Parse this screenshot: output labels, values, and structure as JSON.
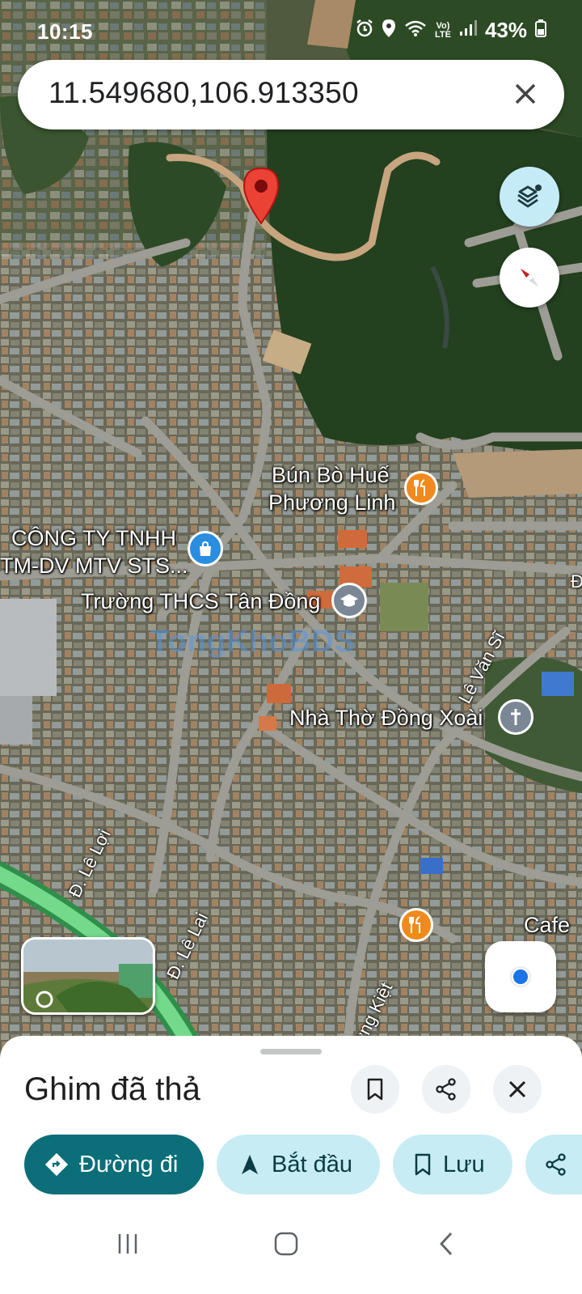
{
  "status_bar": {
    "time": "10:15",
    "net_label": "Vo)\nLTE",
    "battery": "43%"
  },
  "search": {
    "query": "11.549680,106.913350",
    "close_icon": "close-icon"
  },
  "map": {
    "pin_color": "#ea4335",
    "labels": {
      "restaurant_line1": "Bún Bò Huế",
      "restaurant_line2": "Phương Linh",
      "company_line1": "CÔNG TY TNHH",
      "company_line2": "TM-DV MTV STS...",
      "school": "Trường THCS Tân Đồng",
      "church": "Nhà Thờ Đồng Xoài",
      "cafe": "Cafe"
    },
    "streets": {
      "le_van_si": "Lê Văn Sĩ",
      "le_loi": "Đ. Lê Lợi",
      "le_lai": "Đ. Lê Lai",
      "partial": "ờng Kiệt",
      "edge": "Đ"
    },
    "watermark": "TongKhoBDS"
  },
  "sheet": {
    "title": "Ghim đã thả",
    "actions": [
      {
        "label": "Đường đi",
        "icon": "directions-icon"
      },
      {
        "label": "Bắt đầu",
        "icon": "navigation-arrow-icon"
      },
      {
        "label": "Lưu",
        "icon": "bookmark-icon"
      }
    ]
  },
  "colors": {
    "primary": "#0b6e78",
    "chip": "#c7ecf4",
    "accent_blue": "#1a73e8"
  }
}
